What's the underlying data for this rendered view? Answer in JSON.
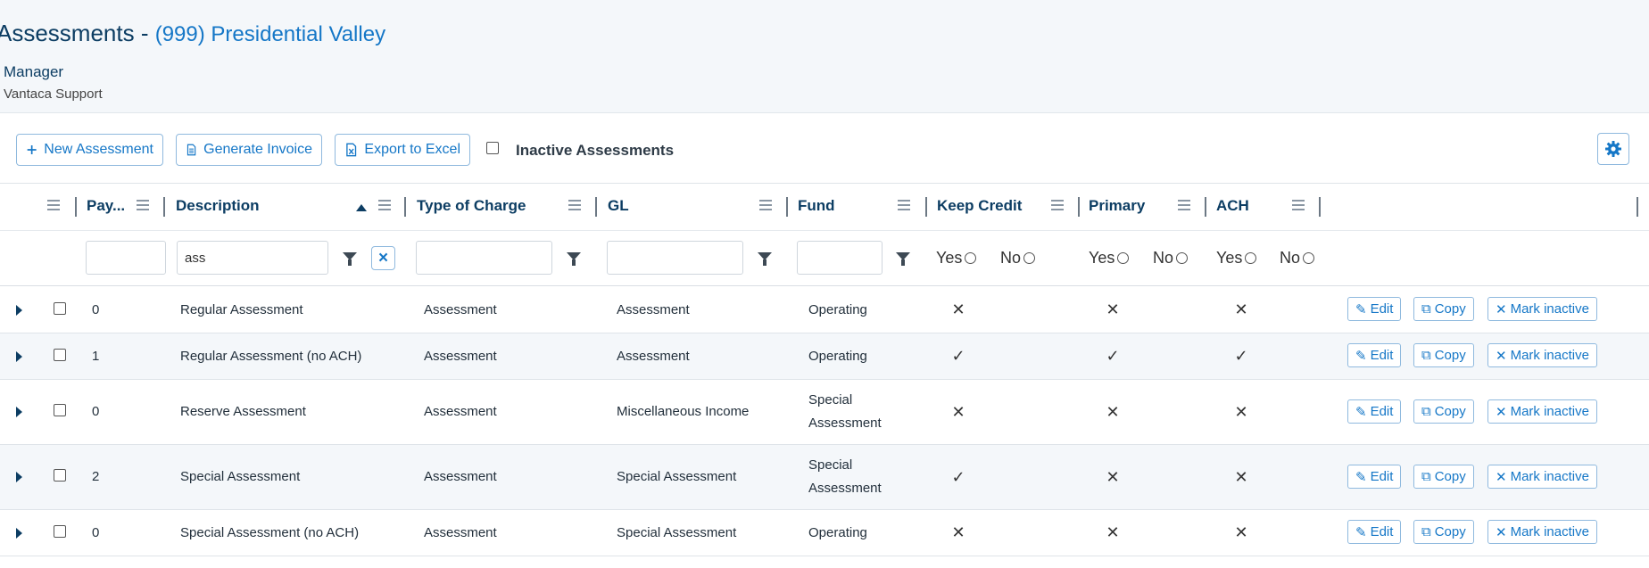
{
  "header": {
    "title": "Assessments - ",
    "association": "(999) Presidential Valley",
    "manager_label": "Manager",
    "manager_value": "Vantaca Support"
  },
  "toolbar": {
    "new_label": "New Assessment",
    "invoice_label": "Generate Invoice",
    "excel_label": "Export to Excel",
    "inactive_label": "Inactive Assessments"
  },
  "columns": {
    "pay": "Pay...",
    "description": "Description",
    "type": "Type of Charge",
    "gl": "GL",
    "fund": "Fund",
    "keep_credit": "Keep Credit",
    "primary": "Primary",
    "ach": "ACH"
  },
  "filters": {
    "description_value": "ass",
    "yes": "Yes",
    "no": "No"
  },
  "actions": {
    "edit": "Edit",
    "copy": "Copy",
    "mark_inactive": "Mark inactive"
  },
  "rows": [
    {
      "pay": "0",
      "description": "Regular Assessment",
      "type": "Assessment",
      "gl": "Assessment",
      "fund": "Operating",
      "keep_credit": "✕",
      "primary": "✕",
      "ach": "✕"
    },
    {
      "pay": "1",
      "description": "Regular Assessment (no ACH)",
      "type": "Assessment",
      "gl": "Assessment",
      "fund": "Operating",
      "keep_credit": "✓",
      "primary": "✓",
      "ach": "✓"
    },
    {
      "pay": "0",
      "description": "Reserve Assessment",
      "type": "Assessment",
      "gl": "Miscellaneous Income",
      "fund": "Special Assessment",
      "keep_credit": "✕",
      "primary": "✕",
      "ach": "✕"
    },
    {
      "pay": "2",
      "description": "Special Assessment",
      "type": "Assessment",
      "gl": "Special Assessment",
      "fund": "Special Assessment",
      "keep_credit": "✓",
      "primary": "✕",
      "ach": "✕"
    },
    {
      "pay": "0",
      "description": "Special Assessment (no ACH)",
      "type": "Assessment",
      "gl": "Special Assessment",
      "fund": "Operating",
      "keep_credit": "✕",
      "primary": "✕",
      "ach": "✕"
    }
  ],
  "colors": {
    "accent": "#1577c7",
    "heading": "#0c3d63",
    "header_bg": "#f4f7fa"
  },
  "icons": [
    "plus-icon",
    "document-icon",
    "excel-icon",
    "gear-icon",
    "column-menu-icon",
    "sort-ascending-icon",
    "filter-icon",
    "clear-filter-icon",
    "expand-caret-icon",
    "pencil-icon",
    "copy-icon",
    "close-icon"
  ]
}
